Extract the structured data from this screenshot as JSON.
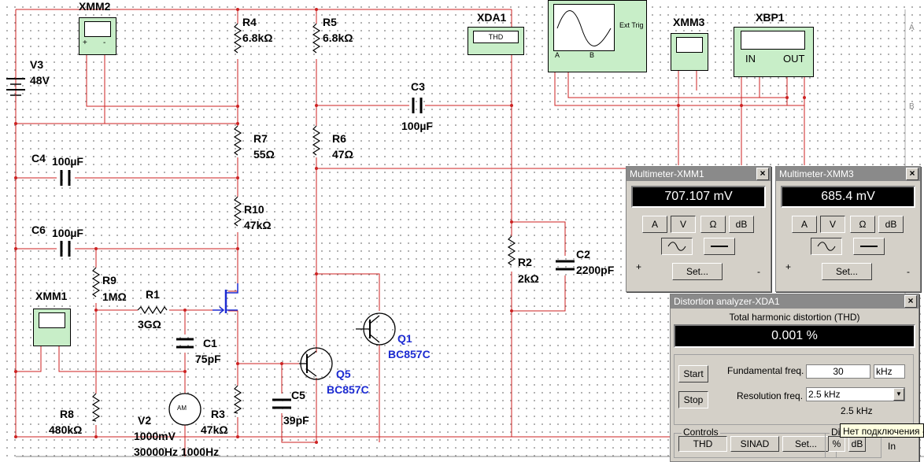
{
  "colors": {
    "wire": "#cc2222",
    "wire_blue": "#1c2bd2",
    "instrument_bg": "#c8eec8",
    "window_bg": "#d4d0c8"
  },
  "components": {
    "v3": {
      "ref": "V3",
      "value": "48V"
    },
    "xmm2": {
      "ref": "XMM2"
    },
    "r4": {
      "ref": "R4",
      "value": "6.8kΩ"
    },
    "r5": {
      "ref": "R5",
      "value": "6.8kΩ"
    },
    "xda1": {
      "ref": "XDA1",
      "display": "THD"
    },
    "xmm3": {
      "ref": "XMM3"
    },
    "xbp1": {
      "ref": "XBP1",
      "in_label": "IN",
      "out_label": "OUT"
    },
    "osc": {
      "ext_trig": "Ext Trig",
      "ch_a": "A",
      "ch_b": "B"
    },
    "c3": {
      "ref": "C3",
      "value": "100µF"
    },
    "r7": {
      "ref": "R7",
      "value": "55Ω"
    },
    "r6": {
      "ref": "R6",
      "value": "47Ω"
    },
    "c4": {
      "ref": "C4",
      "value": "100µF"
    },
    "r10": {
      "ref": "R10",
      "value": "47kΩ"
    },
    "c6": {
      "ref": "C6",
      "value": "100µF"
    },
    "r9": {
      "ref": "R9",
      "value": "1MΩ"
    },
    "r1": {
      "ref": "R1",
      "value": "3GΩ"
    },
    "xmm1": {
      "ref": "XMM1"
    },
    "c1": {
      "ref": "C1",
      "value": "75pF"
    },
    "q1": {
      "ref": "Q1",
      "model": "BC857C"
    },
    "q5": {
      "ref": "Q5",
      "model": "BC857C"
    },
    "c5": {
      "ref": "C5",
      "value": "39pF"
    },
    "r2": {
      "ref": "R2",
      "value": "2kΩ"
    },
    "c2": {
      "ref": "C2",
      "value": "2200pF"
    },
    "r8": {
      "ref": "R8",
      "value": "480kΩ"
    },
    "v2": {
      "ref": "V2",
      "value": "1000mV",
      "freq": "30000Hz 1000Hz",
      "symbol": "AM"
    },
    "r3": {
      "ref": "R3",
      "value": "47kΩ"
    }
  },
  "multimeter_xmm1": {
    "title": "Multimeter-XMM1",
    "reading": "707.107 mV",
    "buttons": [
      "A",
      "V",
      "Ω",
      "dB"
    ],
    "set_label": "Set...",
    "plus": "+",
    "minus": "-"
  },
  "multimeter_xmm3": {
    "title": "Multimeter-XMM3",
    "reading": "685.4 mV",
    "buttons": [
      "A",
      "V",
      "Ω",
      "dB"
    ],
    "set_label": "Set...",
    "plus": "+",
    "minus": "-"
  },
  "distortion": {
    "title": "Distortion analyzer-XDA1",
    "heading": "Total harmonic distortion (THD)",
    "reading": "0.001 %",
    "start": "Start",
    "stop": "Stop",
    "fund_label": "Fundamental freq.",
    "fund_value": "30",
    "fund_unit": "kHz",
    "res_label": "Resolution freq.",
    "res_value": "2.5 kHz",
    "res_readout": "2.5 kHz",
    "controls_label": "Controls",
    "thd_btn": "THD",
    "sinad_btn": "SINAD",
    "set_btn": "Set...",
    "display_label": "Dis",
    "pct_btn": "%",
    "db_btn": "dB",
    "in_label": "In"
  },
  "tooltip": "Нет подключения -",
  "ruler": {
    "a": "A",
    "b": "B"
  }
}
